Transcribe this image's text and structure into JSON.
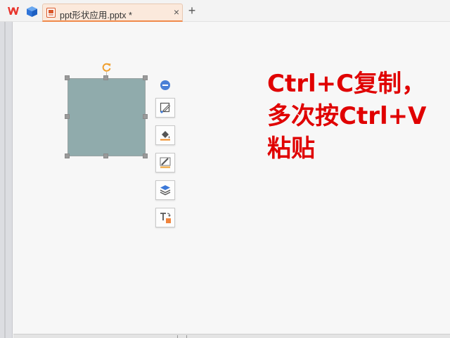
{
  "tabbar": {
    "logo_icon": "wps-logo-icon",
    "cube_icon": "cube-icon",
    "active_tab": {
      "label": "ppt形状应用.pptx *",
      "close_label": "×",
      "icon": "presentation-file-icon"
    },
    "new_tab_label": "+"
  },
  "slide": {
    "shape_fill": "#90abac",
    "selection_handles_color": "#9a9a9a",
    "rotate_handle_color": "#f0a030"
  },
  "side_toolbar": {
    "items": [
      {
        "name": "collapse-icon"
      },
      {
        "name": "edit-shape-icon"
      },
      {
        "name": "fill-bucket-icon"
      },
      {
        "name": "outline-pen-icon"
      },
      {
        "name": "layers-icon"
      },
      {
        "name": "text-wrap-icon"
      }
    ]
  },
  "instruction": {
    "line1": "Ctrl+C复制，",
    "line2": "多次按Ctrl+V",
    "line3": "粘贴",
    "color": "#e00000"
  }
}
